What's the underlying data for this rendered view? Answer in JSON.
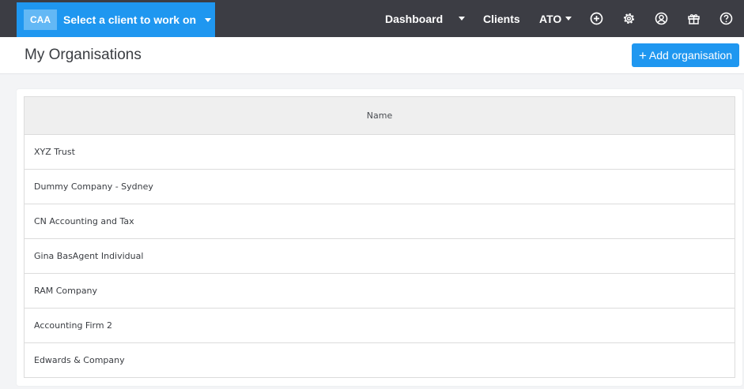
{
  "topbar": {
    "client_badge": "CAA",
    "client_select_label": "Select a client to work on",
    "nav": {
      "dashboard": "Dashboard",
      "clients": "Clients",
      "ato": "ATO"
    },
    "icons": [
      "dropdown-caret-icon",
      "add-circle-icon",
      "gear-icon",
      "user-circle-icon",
      "gift-icon",
      "help-icon"
    ]
  },
  "page": {
    "title": "My Organisations",
    "add_button_label": "Add organisation"
  },
  "table": {
    "columns": [
      "Name"
    ],
    "rows": [
      "XYZ Trust",
      "Dummy Company - Sydney",
      "CN Accounting and Tax",
      "Gina BasAgent Individual",
      "RAM Company",
      "Accounting Firm 2",
      "Edwards & Company"
    ]
  },
  "colors": {
    "topbar_bg": "#3c3d44",
    "accent": "#1f97f0",
    "badge_bg": "#63b8f5",
    "page_bg": "#f3f4f6",
    "table_header_bg": "#efefef"
  }
}
